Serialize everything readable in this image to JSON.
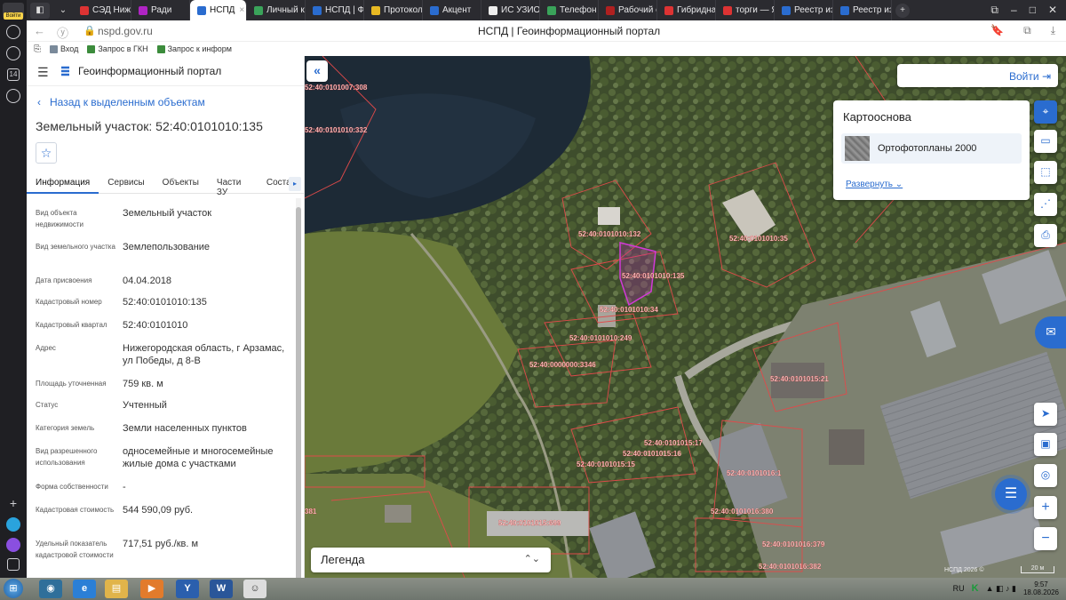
{
  "browser": {
    "side_badge": "Войти",
    "side_count": "14",
    "tabs": [
      {
        "label": "СЭД Ниж",
        "color": "#d33"
      },
      {
        "label": "Ради",
        "color": "#b024c4"
      },
      {
        "label": "НСПД",
        "color": "#2a6ccf",
        "active": true
      },
      {
        "label": "Личный к",
        "color": "#3aa35a"
      },
      {
        "label": "НСПД | Ф",
        "color": "#2a6ccf"
      },
      {
        "label": "Протокол",
        "color": "#e8b923"
      },
      {
        "label": "Акцент",
        "color": "#2a6ccf"
      },
      {
        "label": "ИС УЗИО",
        "color": "#eee"
      },
      {
        "label": "Телефон",
        "color": "#3aa35a"
      },
      {
        "label": "Рабочий с",
        "color": "#b02020"
      },
      {
        "label": "Гибридна",
        "color": "#d33"
      },
      {
        "label": "торги — Я",
        "color": "#d33"
      },
      {
        "label": "Реестр из",
        "color": "#2a6ccf"
      },
      {
        "label": "Реестр из",
        "color": "#2a6ccf"
      }
    ],
    "url": "nspd.gov.ru",
    "page_title": "НСПД | Геоинформационный портал",
    "bookmarks": [
      "Вход",
      "Запрос в ГКН",
      "Запрос к информ"
    ]
  },
  "panel": {
    "app_title": "Геоинформационный портал",
    "back_link": "Назад к выделенным объектам",
    "object_title": "Земельный участок: 52:40:0101010:135",
    "tabs": [
      "Информация",
      "Сервисы",
      "Объекты",
      "Части ЗУ",
      "Состав"
    ],
    "fields": [
      {
        "k": "Вид объекта недвижимости",
        "v": "Земельный участок"
      },
      {
        "k": "Вид земельного участка",
        "v": "Землепользование"
      },
      {
        "k": "Дата присвоения",
        "v": "04.04.2018"
      },
      {
        "k": "Кадастровый номер",
        "v": "52:40:0101010:135"
      },
      {
        "k": "Кадастровый квартал",
        "v": "52:40:0101010"
      },
      {
        "k": "Адрес",
        "v": "Нижегородская область, г Арзамас, ул Победы, д 8-В"
      },
      {
        "k": "Площадь уточненная",
        "v": "759 кв. м"
      },
      {
        "k": "Статус",
        "v": "Учтенный"
      },
      {
        "k": "Категория земель",
        "v": "Земли населенных пунктов"
      },
      {
        "k": "Вид разрешенного использования",
        "v": "односемейные и многосемейные жилые дома с участками"
      },
      {
        "k": "Форма собственности",
        "v": "-"
      },
      {
        "k": "Кадастровая стоимость",
        "v": "544 590,09 руб."
      },
      {
        "k": "Удельный показатель кадастровой стоимости",
        "v": "717,51 руб./кв. м"
      }
    ]
  },
  "map": {
    "login": "Войти",
    "basemap_title": "Картооснова",
    "basemap_item": "Ортофотопланы 2000",
    "expand": "Развернуть",
    "legend": "Легенда",
    "attribution": "НСПД 2026 ©",
    "scale": "20 м",
    "parcel_labels": [
      "52:40:0101010:132",
      "52:40:0101010:35",
      "52:40:0101010:135",
      "52:40:0101010:34",
      "52:40:0101010:249",
      "52:40:0000000:3346",
      "52:40:0101015:21",
      "52:40:0101015:17",
      "52:40:0101015:16",
      "52:40:0101015:15",
      "52:40:0101016:1",
      "52:40:0101016:380",
      "52:40:0101015:699",
      "52:40:0101016:379",
      "52:40:0101016:382",
      "52:40:0101007:308",
      "52:40:0101010:332",
      "381"
    ]
  },
  "taskbar": {
    "lang": "RU",
    "time": "9:57",
    "date": "18.08.2026"
  }
}
